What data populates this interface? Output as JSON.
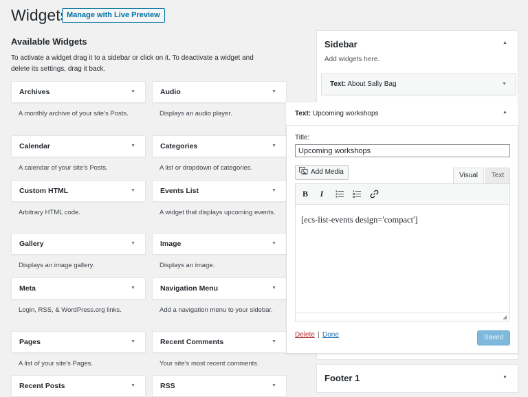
{
  "header": {
    "title": "Widgets",
    "live_preview": "Manage with Live Preview"
  },
  "available": {
    "title": "Available Widgets",
    "description": "To activate a widget drag it to a sidebar or click on it. To deactivate a widget and delete its settings, drag it back.",
    "widgets": [
      {
        "name": "Archives",
        "desc": "A monthly archive of your site’s Posts."
      },
      {
        "name": "Audio",
        "desc": "Displays an audio player."
      },
      {
        "name": "Calendar",
        "desc": "A calendar of your site’s Posts."
      },
      {
        "name": "Categories",
        "desc": "A list or dropdown of categories."
      },
      {
        "name": "Custom HTML",
        "desc": "Arbitrary HTML code."
      },
      {
        "name": "Events List",
        "desc": "A widget that displays upcoming events."
      },
      {
        "name": "Gallery",
        "desc": "Displays an image gallery."
      },
      {
        "name": "Image",
        "desc": "Displays an image."
      },
      {
        "name": "Meta",
        "desc": "Login, RSS, & WordPress.org links."
      },
      {
        "name": "Navigation Menu",
        "desc": "Add a navigation menu to your sidebar."
      },
      {
        "name": "Pages",
        "desc": "A list of your site’s Pages."
      },
      {
        "name": "Recent Comments",
        "desc": "Your site’s most recent comments."
      },
      {
        "name": "Recent Posts",
        "desc": ""
      },
      {
        "name": "RSS",
        "desc": ""
      }
    ]
  },
  "sidebar": {
    "title": "Sidebar",
    "subtitle": "Add widgets here.",
    "placed_widget": {
      "type": "Text:",
      "title": "About Sally Bag"
    },
    "open_widget": {
      "type": "Text:",
      "title": "Upcoming workshops",
      "title_label": "Title:",
      "title_value": "Upcoming workshops",
      "add_media": "Add Media",
      "tab_visual": "Visual",
      "tab_text": "Text",
      "toolbar": {
        "bold": "B",
        "italic": "I"
      },
      "content": "[ecs-list-events design='compact']",
      "delete": "Delete",
      "separator": "|",
      "done": "Done",
      "saved": "Saved"
    }
  },
  "footer": {
    "title": "Footer 1"
  },
  "icons": {
    "collapse": "▼",
    "expand": "▲",
    "bold": "bold-icon",
    "italic": "italic-icon",
    "bullet_list": "bullet-list-icon",
    "numbered_list": "numbered-list-icon",
    "link": "link-icon",
    "media": "media-icon"
  },
  "colors": {
    "accent": "#0071a1",
    "delete": "#b32d2e",
    "saved_button": "#7eb9dc"
  }
}
